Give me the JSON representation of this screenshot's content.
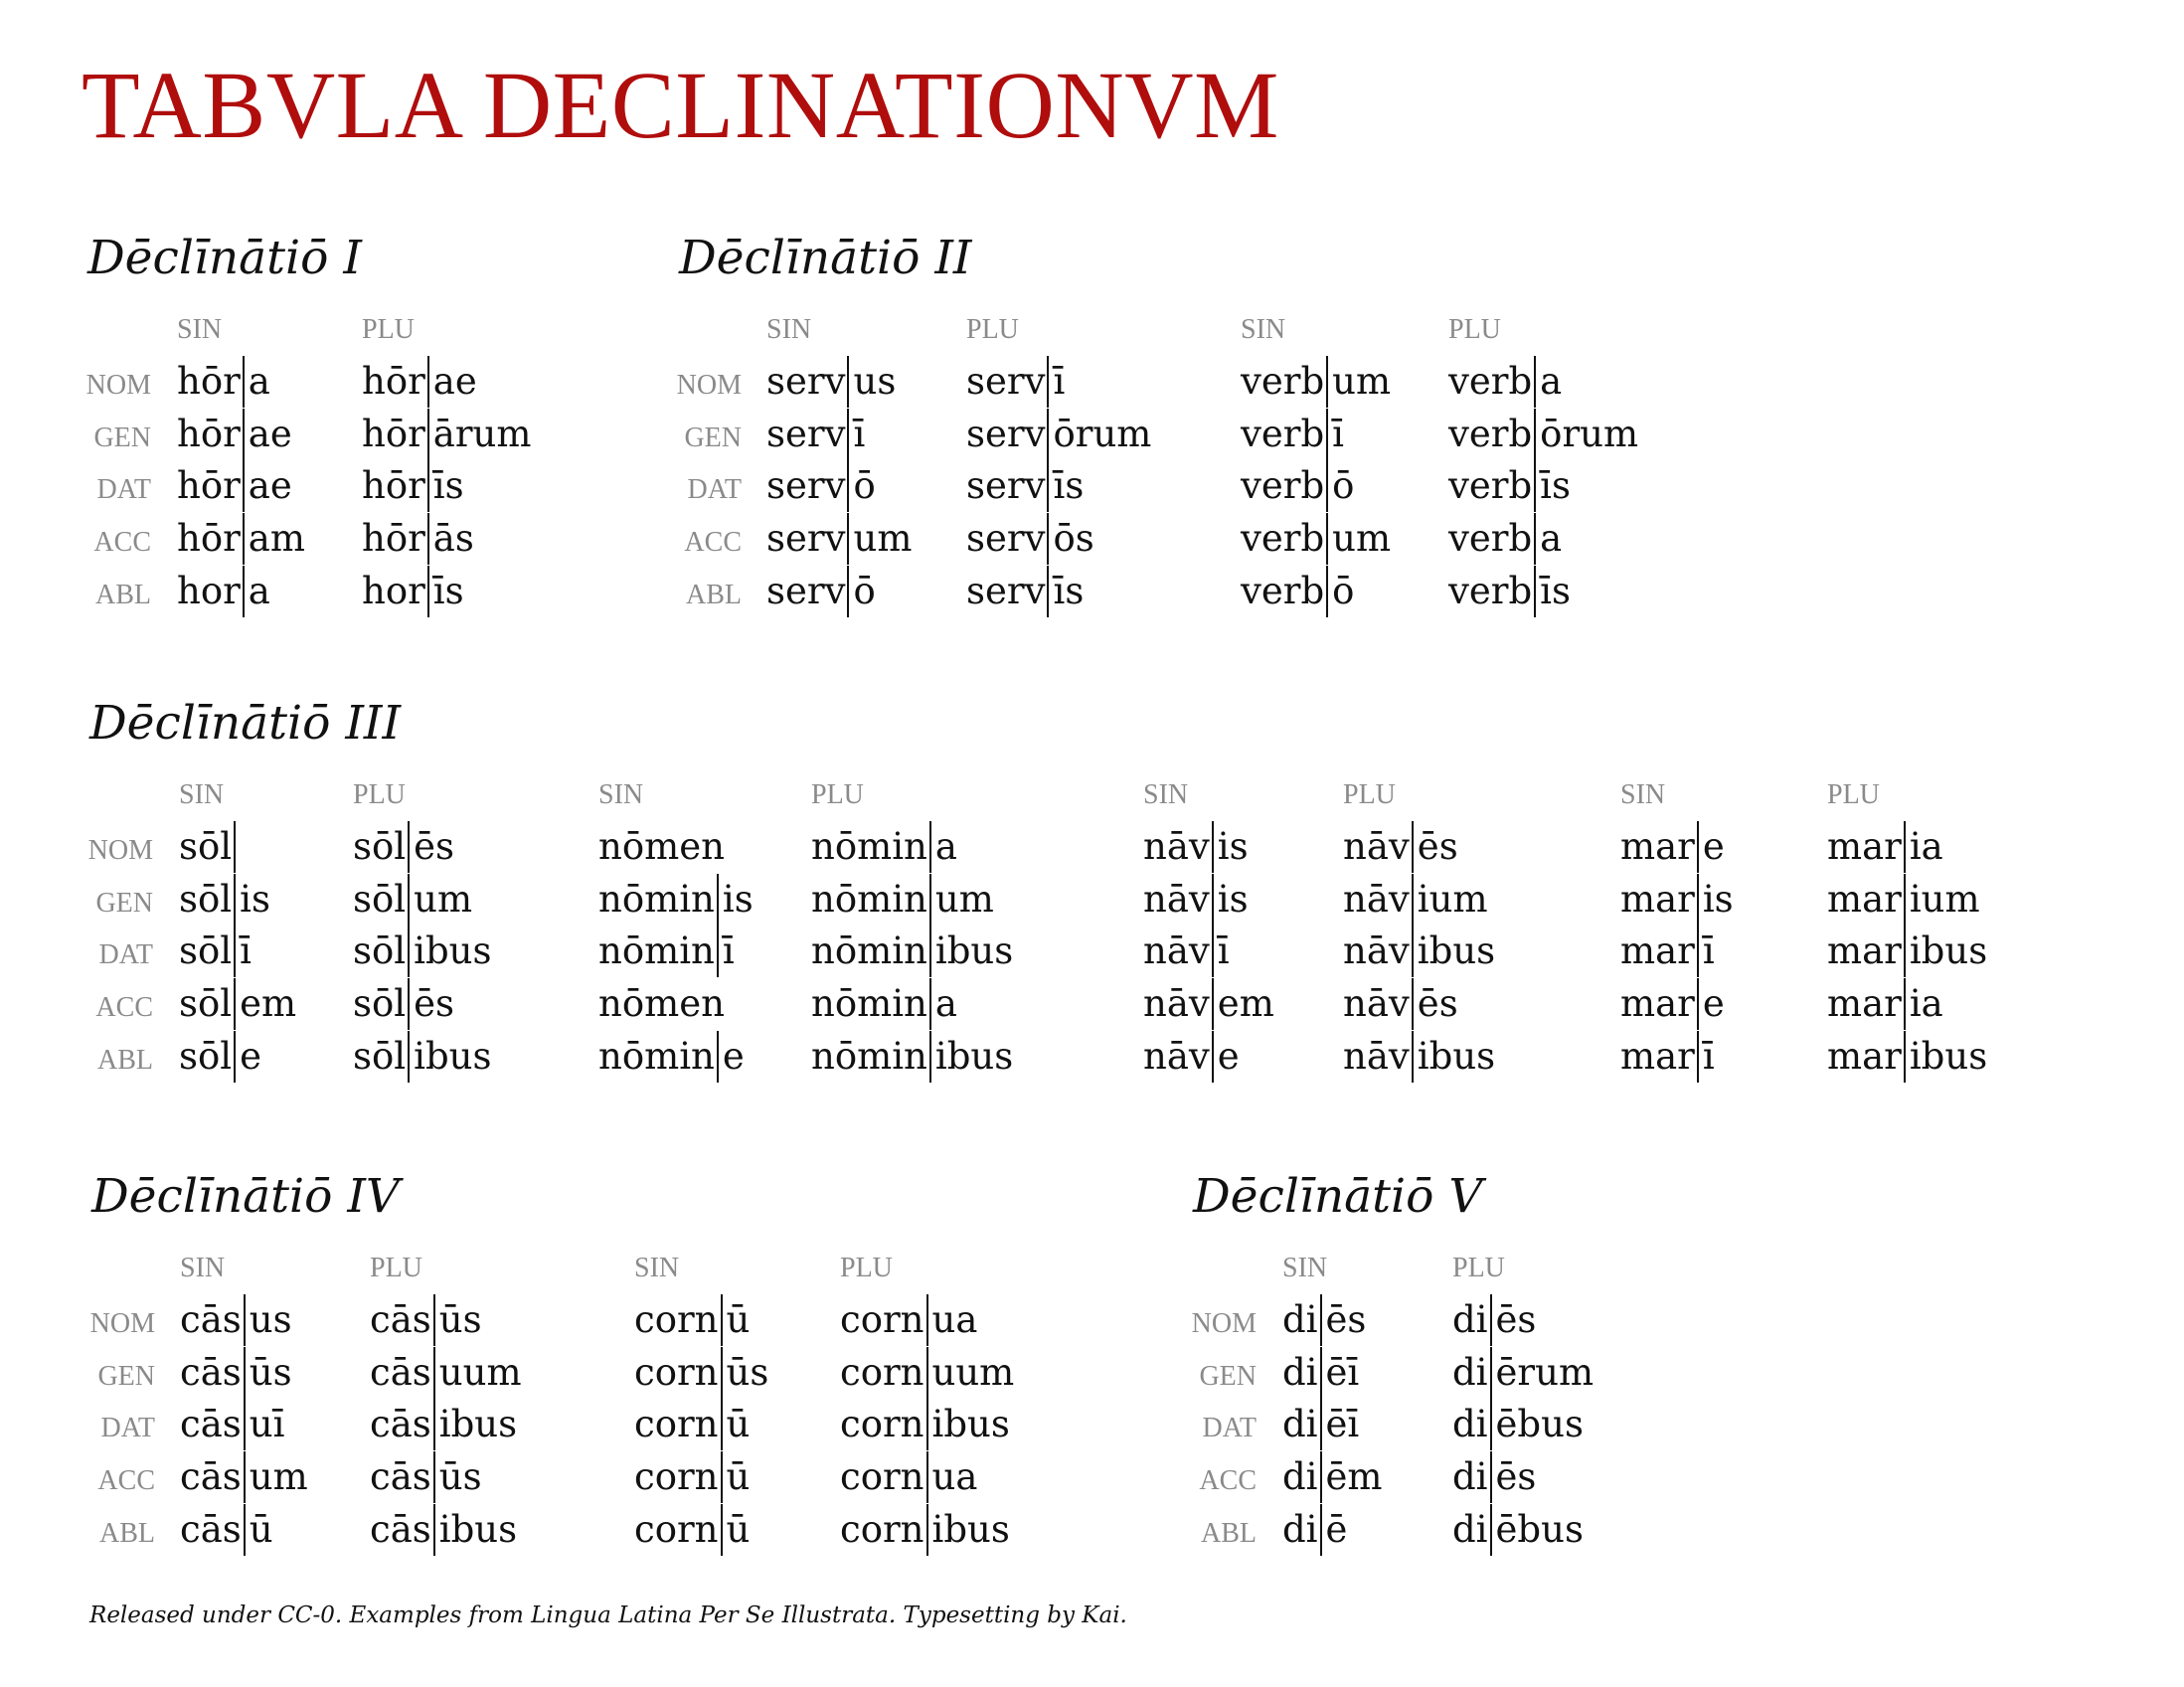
{
  "title": "TABVLA DECLINATIONVM",
  "footer": "Released under CC-0. Examples from Lingua Latina Per Se Illustrata. Typesetting by Kai.",
  "sections": [
    {
      "title": "Dēclīnātiō I",
      "cases": [
        "NOM",
        "GEN",
        "DAT",
        "ACC",
        "ABL"
      ],
      "columns": [
        {
          "header": "SIN",
          "forms": [
            [
              "hōr",
              "a"
            ],
            [
              "hōr",
              "ae"
            ],
            [
              "hōr",
              "ae"
            ],
            [
              "hōr",
              "am"
            ],
            [
              "hor",
              "a"
            ]
          ]
        },
        {
          "header": "PLU",
          "forms": [
            [
              "hōr",
              "ae"
            ],
            [
              "hōr",
              "ārum"
            ],
            [
              "hōr",
              "īs"
            ],
            [
              "hōr",
              "ās"
            ],
            [
              "hor",
              "īs"
            ]
          ]
        }
      ]
    },
    {
      "title": "Dēclīnātiō II",
      "cases": [
        "NOM",
        "GEN",
        "DAT",
        "ACC",
        "ABL"
      ],
      "columns": [
        {
          "header": "SIN",
          "forms": [
            [
              "serv",
              "us"
            ],
            [
              "serv",
              "ī"
            ],
            [
              "serv",
              "ō"
            ],
            [
              "serv",
              "um"
            ],
            [
              "serv",
              "ō"
            ]
          ]
        },
        {
          "header": "PLU",
          "forms": [
            [
              "serv",
              "ī"
            ],
            [
              "serv",
              "ōrum"
            ],
            [
              "serv",
              "īs"
            ],
            [
              "serv",
              "ōs"
            ],
            [
              "serv",
              "īs"
            ]
          ]
        },
        {
          "header": "SIN",
          "forms": [
            [
              "verb",
              "um"
            ],
            [
              "verb",
              "ī"
            ],
            [
              "verb",
              "ō"
            ],
            [
              "verb",
              "um"
            ],
            [
              "verb",
              "ō"
            ]
          ]
        },
        {
          "header": "PLU",
          "forms": [
            [
              "verb",
              "a"
            ],
            [
              "verb",
              "ōrum"
            ],
            [
              "verb",
              "īs"
            ],
            [
              "verb",
              "a"
            ],
            [
              "verb",
              "īs"
            ]
          ]
        }
      ]
    },
    {
      "title": "Dēclīnātiō III",
      "cases": [
        "NOM",
        "GEN",
        "DAT",
        "ACC",
        "ABL"
      ],
      "columns": [
        {
          "header": "SIN",
          "forms": [
            [
              "sōl",
              ""
            ],
            [
              "sōl",
              "is"
            ],
            [
              "sōl",
              "ī"
            ],
            [
              "sōl",
              "em"
            ],
            [
              "sōl",
              "e"
            ]
          ]
        },
        {
          "header": "PLU",
          "forms": [
            [
              "sōl",
              "ēs"
            ],
            [
              "sōl",
              "um"
            ],
            [
              "sōl",
              "ibus"
            ],
            [
              "sōl",
              "ēs"
            ],
            [
              "sōl",
              "ibus"
            ]
          ]
        },
        {
          "header": "SIN",
          "forms": [
            [
              "nōmen",
              null
            ],
            [
              "nōmin",
              "is"
            ],
            [
              "nōmin",
              "ī"
            ],
            [
              "nōmen",
              null
            ],
            [
              "nōmin",
              "e"
            ]
          ]
        },
        {
          "header": "PLU",
          "forms": [
            [
              "nōmin",
              "a"
            ],
            [
              "nōmin",
              "um"
            ],
            [
              "nōmin",
              "ibus"
            ],
            [
              "nōmin",
              "a"
            ],
            [
              "nōmin",
              "ibus"
            ]
          ]
        },
        {
          "header": "SIN",
          "forms": [
            [
              "nāv",
              "is"
            ],
            [
              "nāv",
              "is"
            ],
            [
              "nāv",
              "ī"
            ],
            [
              "nāv",
              "em"
            ],
            [
              "nāv",
              "e"
            ]
          ]
        },
        {
          "header": "PLU",
          "forms": [
            [
              "nāv",
              "ēs"
            ],
            [
              "nāv",
              "ium"
            ],
            [
              "nāv",
              "ibus"
            ],
            [
              "nāv",
              "ēs"
            ],
            [
              "nāv",
              "ibus"
            ]
          ]
        },
        {
          "header": "SIN",
          "forms": [
            [
              "mar",
              "e"
            ],
            [
              "mar",
              "is"
            ],
            [
              "mar",
              "ī"
            ],
            [
              "mar",
              "e"
            ],
            [
              "mar",
              "ī"
            ]
          ]
        },
        {
          "header": "PLU",
          "forms": [
            [
              "mar",
              "ia"
            ],
            [
              "mar",
              "ium"
            ],
            [
              "mar",
              "ibus"
            ],
            [
              "mar",
              "ia"
            ],
            [
              "mar",
              "ibus"
            ]
          ]
        }
      ]
    },
    {
      "title": "Dēclīnātiō IV",
      "cases": [
        "NOM",
        "GEN",
        "DAT",
        "ACC",
        "ABL"
      ],
      "columns": [
        {
          "header": "SIN",
          "forms": [
            [
              "cās",
              "us"
            ],
            [
              "cās",
              "ūs"
            ],
            [
              "cās",
              "uī"
            ],
            [
              "cās",
              "um"
            ],
            [
              "cās",
              "ū"
            ]
          ]
        },
        {
          "header": "PLU",
          "forms": [
            [
              "cās",
              "ūs"
            ],
            [
              "cās",
              "uum"
            ],
            [
              "cās",
              "ibus"
            ],
            [
              "cās",
              "ūs"
            ],
            [
              "cās",
              "ibus"
            ]
          ]
        },
        {
          "header": "SIN",
          "forms": [
            [
              "corn",
              "ū"
            ],
            [
              "corn",
              "ūs"
            ],
            [
              "corn",
              "ū"
            ],
            [
              "corn",
              "ū"
            ],
            [
              "corn",
              "ū"
            ]
          ]
        },
        {
          "header": "PLU",
          "forms": [
            [
              "corn",
              "ua"
            ],
            [
              "corn",
              "uum"
            ],
            [
              "corn",
              "ibus"
            ],
            [
              "corn",
              "ua"
            ],
            [
              "corn",
              "ibus"
            ]
          ]
        }
      ]
    },
    {
      "title": "Dēclīnātiō V",
      "cases": [
        "NOM",
        "GEN",
        "DAT",
        "ACC",
        "ABL"
      ],
      "columns": [
        {
          "header": "SIN",
          "forms": [
            [
              "di",
              "ēs"
            ],
            [
              "di",
              "ēī"
            ],
            [
              "di",
              "ēī"
            ],
            [
              "di",
              "ēm"
            ],
            [
              "di",
              "ē"
            ]
          ]
        },
        {
          "header": "PLU",
          "forms": [
            [
              "di",
              "ēs"
            ],
            [
              "di",
              "ērum"
            ],
            [
              "di",
              "ēbus"
            ],
            [
              "di",
              "ēs"
            ],
            [
              "di",
              "ēbus"
            ]
          ]
        }
      ]
    }
  ]
}
